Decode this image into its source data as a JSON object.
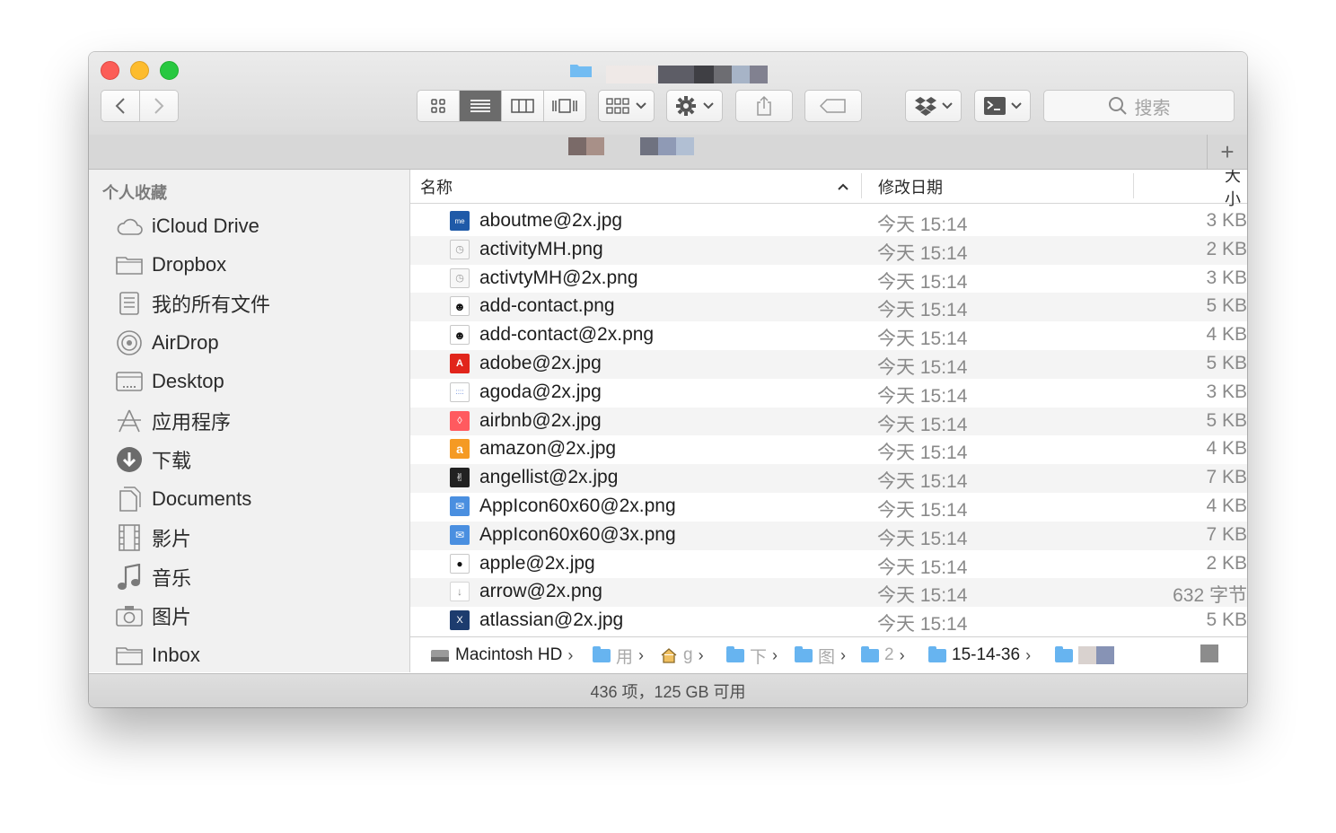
{
  "toolbar": {
    "search_placeholder": "搜索",
    "view_modes": [
      "icon",
      "list",
      "column",
      "coverflow"
    ],
    "active_view": "list"
  },
  "tabbar": {
    "add_label": "+"
  },
  "sidebar": {
    "header": "个人收藏",
    "items": [
      {
        "label": "iCloud Drive",
        "icon": "cloud-icon"
      },
      {
        "label": "Dropbox",
        "icon": "folder-icon"
      },
      {
        "label": "我的所有文件",
        "icon": "all-files-icon"
      },
      {
        "label": "AirDrop",
        "icon": "airdrop-icon"
      },
      {
        "label": "Desktop",
        "icon": "desktop-icon"
      },
      {
        "label": "应用程序",
        "icon": "applications-icon"
      },
      {
        "label": "下载",
        "icon": "download-icon"
      },
      {
        "label": "Documents",
        "icon": "documents-icon"
      },
      {
        "label": "影片",
        "icon": "film-icon"
      },
      {
        "label": "音乐",
        "icon": "music-icon"
      },
      {
        "label": "图片",
        "icon": "camera-icon"
      },
      {
        "label": "Inbox",
        "icon": "folder-icon"
      }
    ]
  },
  "list": {
    "columns": {
      "name": "名称",
      "date": "修改日期",
      "size": "大小"
    },
    "rows": [
      {
        "name": "aboutme@2x.jpg",
        "date": "今天 15:14",
        "size": "3 KB",
        "icon": "aboutme-icon",
        "color": "#1f5aa8"
      },
      {
        "name": "activityMH.png",
        "date": "今天 15:14",
        "size": "2 KB",
        "icon": "activity-icon",
        "color": "#f5f5f5"
      },
      {
        "name": "activtyMH@2x.png",
        "date": "今天 15:14",
        "size": "3 KB",
        "icon": "activity-icon",
        "color": "#f5f5f5"
      },
      {
        "name": "add-contact.png",
        "date": "今天 15:14",
        "size": "5 KB",
        "icon": "add-contact-icon",
        "color": "#ffffff"
      },
      {
        "name": "add-contact@2x.png",
        "date": "今天 15:14",
        "size": "4 KB",
        "icon": "add-contact-icon",
        "color": "#ffffff"
      },
      {
        "name": "adobe@2x.jpg",
        "date": "今天 15:14",
        "size": "5 KB",
        "icon": "adobe-icon",
        "color": "#e1251b"
      },
      {
        "name": "agoda@2x.jpg",
        "date": "今天 15:14",
        "size": "3 KB",
        "icon": "agoda-icon",
        "color": "#ffffff"
      },
      {
        "name": "airbnb@2x.jpg",
        "date": "今天 15:14",
        "size": "5 KB",
        "icon": "airbnb-icon",
        "color": "#ff5a5f"
      },
      {
        "name": "amazon@2x.jpg",
        "date": "今天 15:14",
        "size": "4 KB",
        "icon": "amazon-icon",
        "color": "#f59a23"
      },
      {
        "name": "angellist@2x.jpg",
        "date": "今天 15:14",
        "size": "7 KB",
        "icon": "angellist-icon",
        "color": "#222222"
      },
      {
        "name": "AppIcon60x60@2x.png",
        "date": "今天 15:14",
        "size": "4 KB",
        "icon": "appicon-icon",
        "color": "#4a8fe0"
      },
      {
        "name": "AppIcon60x60@3x.png",
        "date": "今天 15:14",
        "size": "7 KB",
        "icon": "appicon-icon",
        "color": "#4a8fe0"
      },
      {
        "name": "apple@2x.jpg",
        "date": "今天 15:14",
        "size": "2 KB",
        "icon": "apple-icon",
        "color": "#ffffff"
      },
      {
        "name": "arrow@2x.png",
        "date": "今天 15:14",
        "size": "632 字节",
        "icon": "arrow-icon",
        "color": "#ffffff"
      },
      {
        "name": "atlassian@2x.jpg",
        "date": "今天 15:14",
        "size": "5 KB",
        "icon": "atlassian-icon",
        "color": "#1d3c6e"
      }
    ]
  },
  "pathbar": {
    "segments": [
      {
        "label": "Macintosh HD",
        "icon": "hard-drive-icon"
      },
      {
        "label": "用",
        "icon": "users-folder-icon"
      },
      {
        "label": "g",
        "icon": "home-icon"
      },
      {
        "label": "下",
        "icon": "download-folder-icon"
      },
      {
        "label": "图",
        "icon": "folder-icon"
      },
      {
        "label": "2",
        "icon": "folder-icon"
      },
      {
        "label": "15-14-36",
        "icon": "folder-icon"
      }
    ]
  },
  "status": {
    "text": "436 项，125 GB 可用"
  }
}
